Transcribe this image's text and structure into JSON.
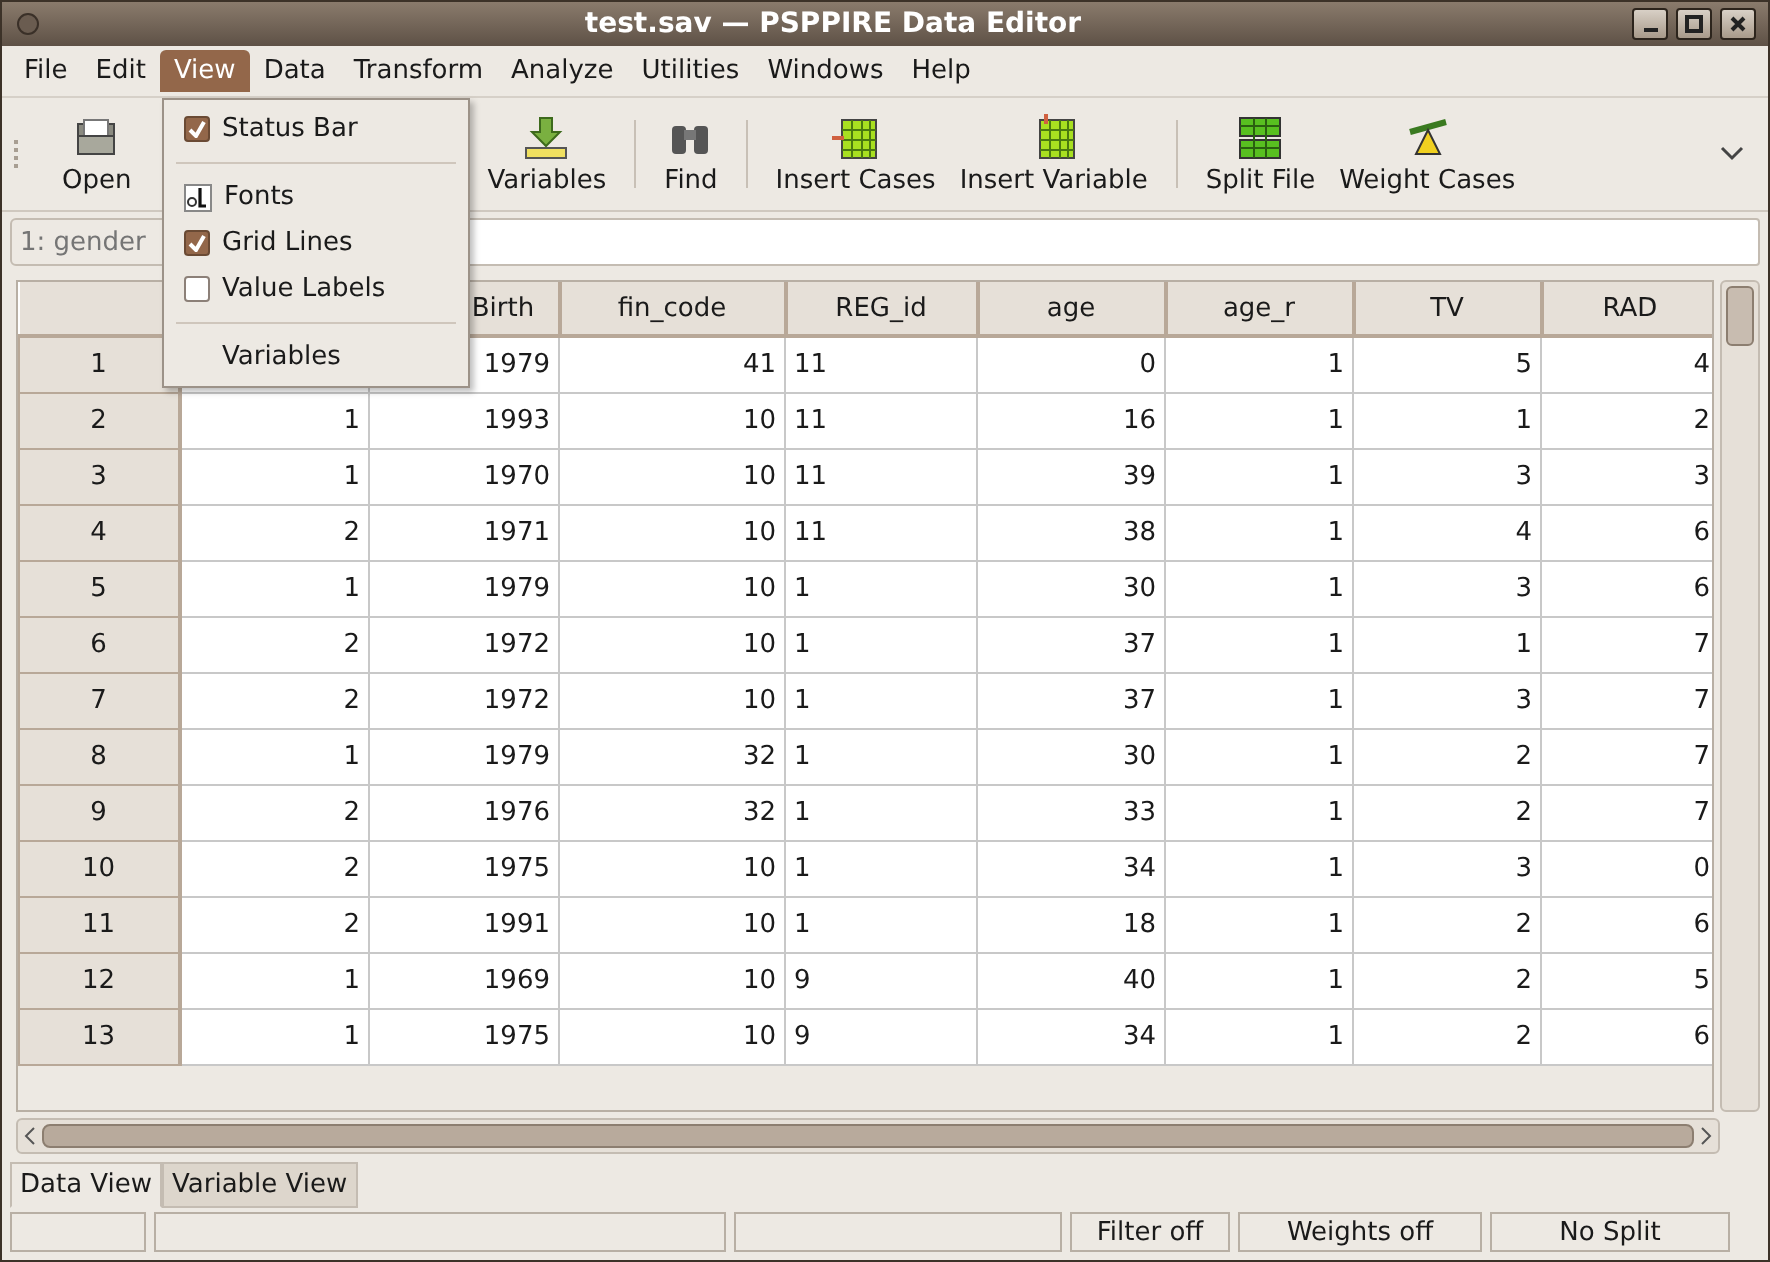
{
  "window": {
    "title": "test.sav — PSPPIRE Data Editor"
  },
  "menubar": [
    {
      "label": "File",
      "selected": false
    },
    {
      "label": "Edit",
      "selected": false
    },
    {
      "label": "View",
      "selected": true
    },
    {
      "label": "Data",
      "selected": false
    },
    {
      "label": "Transform",
      "selected": false
    },
    {
      "label": "Analyze",
      "selected": false
    },
    {
      "label": "Utilities",
      "selected": false
    },
    {
      "label": "Windows",
      "selected": false
    },
    {
      "label": "Help",
      "selected": false
    }
  ],
  "view_menu": [
    {
      "kind": "check",
      "label": "Status Bar",
      "checked": true
    },
    {
      "kind": "separator"
    },
    {
      "kind": "icon",
      "label": "Fonts"
    },
    {
      "kind": "check",
      "label": "Grid Lines",
      "checked": true
    },
    {
      "kind": "check",
      "label": "Value Labels",
      "checked": false
    },
    {
      "kind": "separator"
    },
    {
      "kind": "plain",
      "label": "Variables"
    }
  ],
  "toolbar": [
    {
      "kind": "open",
      "label": "Open"
    },
    {
      "kind": "gap"
    },
    {
      "kind": "variables",
      "label": "Variables"
    },
    {
      "kind": "separator"
    },
    {
      "kind": "find",
      "label": "Find"
    },
    {
      "kind": "separator"
    },
    {
      "kind": "insert-cases",
      "label": "Insert Cases"
    },
    {
      "kind": "insert-variable",
      "label": "Insert Variable"
    },
    {
      "kind": "separator"
    },
    {
      "kind": "split-file",
      "label": "Split File"
    },
    {
      "kind": "weight-cases",
      "label": "Weight Cases"
    }
  ],
  "cell_ref": {
    "placeholder": "1: gender"
  },
  "table": {
    "columns": [
      {
        "right_aligned": true
      },
      {
        "name": "Birth",
        "right_aligned": true
      },
      {
        "name": "fin_code",
        "right_aligned": true
      },
      {
        "name": "REG_id",
        "right_aligned": false
      },
      {
        "name": "age",
        "right_aligned": true
      },
      {
        "name": "age_r",
        "right_aligned": true
      },
      {
        "name": "TV",
        "right_aligned": true
      },
      {
        "name": "RAD",
        "right_aligned": true
      }
    ],
    "rows": [
      {
        "case": "1",
        "cells": [
          null,
          "1979",
          "41",
          "11",
          "0",
          "1",
          "5",
          "4"
        ]
      },
      {
        "case": "2",
        "cells": [
          "1",
          "1993",
          "10",
          "11",
          "16",
          "1",
          "1",
          "2"
        ]
      },
      {
        "case": "3",
        "cells": [
          "1",
          "1970",
          "10",
          "11",
          "39",
          "1",
          "3",
          "3"
        ]
      },
      {
        "case": "4",
        "cells": [
          "2",
          "1971",
          "10",
          "11",
          "38",
          "1",
          "4",
          "6"
        ]
      },
      {
        "case": "5",
        "cells": [
          "1",
          "1979",
          "10",
          "1",
          "30",
          "1",
          "3",
          "6"
        ]
      },
      {
        "case": "6",
        "cells": [
          "2",
          "1972",
          "10",
          "1",
          "37",
          "1",
          "1",
          "7"
        ]
      },
      {
        "case": "7",
        "cells": [
          "2",
          "1972",
          "10",
          "1",
          "37",
          "1",
          "3",
          "7"
        ]
      },
      {
        "case": "8",
        "cells": [
          "1",
          "1979",
          "32",
          "1",
          "30",
          "1",
          "2",
          "7"
        ]
      },
      {
        "case": "9",
        "cells": [
          "2",
          "1976",
          "32",
          "1",
          "33",
          "1",
          "2",
          "7"
        ]
      },
      {
        "case": "10",
        "cells": [
          "2",
          "1975",
          "10",
          "1",
          "34",
          "1",
          "3",
          "0"
        ]
      },
      {
        "case": "11",
        "cells": [
          "2",
          "1991",
          "10",
          "1",
          "18",
          "1",
          "2",
          "6"
        ]
      },
      {
        "case": "12",
        "cells": [
          "1",
          "1969",
          "10",
          "9",
          "40",
          "1",
          "2",
          "5"
        ]
      },
      {
        "case": "13",
        "cells": [
          "1",
          "1975",
          "10",
          "9",
          "34",
          "1",
          "2",
          "6"
        ]
      }
    ]
  },
  "tabs": [
    {
      "label": "Data View",
      "selected": true
    },
    {
      "label": "Variable View",
      "selected": false
    }
  ],
  "status_bar": [
    "Filter off",
    "Weights off",
    "No Split"
  ]
}
